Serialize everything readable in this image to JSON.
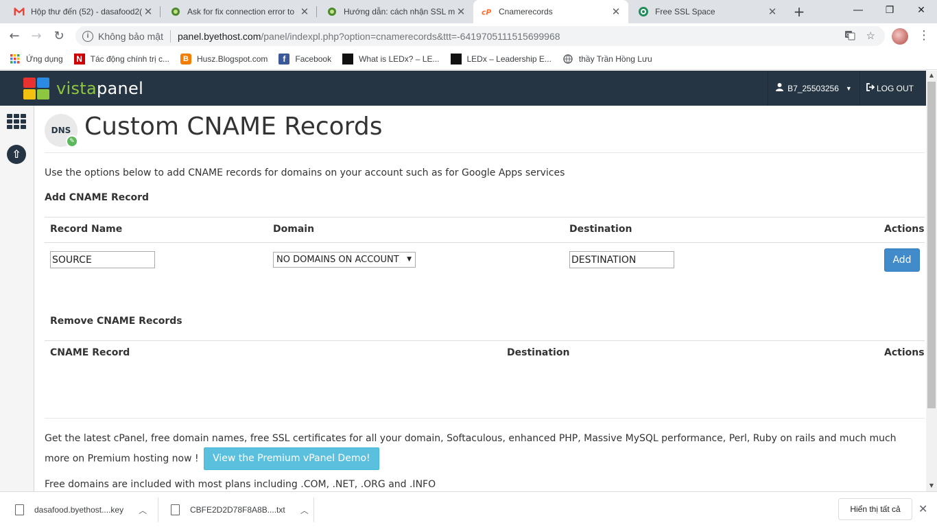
{
  "browser": {
    "tabs": [
      {
        "title": "Hộp thư đến (52) - dasafood2(",
        "icon": "gmail-icon"
      },
      {
        "title": "Ask for fix connection error to",
        "icon": "forum-icon"
      },
      {
        "title": "Hướng dẫn: cách nhận SSL miễ",
        "icon": "forum-icon"
      },
      {
        "title": "Cnamerecords",
        "icon": "cpanel-icon"
      },
      {
        "title": "Free SSL Space",
        "icon": "ssl-icon"
      }
    ],
    "security_label": "Không bảo mật",
    "url_host": "panel.byethost.com",
    "url_path": "/panel/indexpl.php?option=cnamerecords&ttt=-6419705111515699968",
    "bookmarks": [
      {
        "label": "Ứng dụng",
        "icon": "apps-grid-icon"
      },
      {
        "label": "Tác động chính trị c...",
        "icon": "n-logo-icon"
      },
      {
        "label": "Husz.Blogspot.com",
        "icon": "blogger-icon"
      },
      {
        "label": "Facebook",
        "icon": "facebook-icon"
      },
      {
        "label": "What is LEDx?  – LE...",
        "icon": "ledx-icon"
      },
      {
        "label": "LEDx – Leadership E...",
        "icon": "ledx-icon"
      },
      {
        "label": "thầy Trần Hồng Lưu",
        "icon": "globe-icon"
      }
    ]
  },
  "header": {
    "logo_vista": "vista",
    "logo_panel": "panel",
    "username": "B7_25503256",
    "logout_label": "LOG OUT"
  },
  "page": {
    "title": "Custom CNAME Records",
    "dns_badge": "DNS",
    "intro": "Use the options below to add CNAME records for domains on your account such as for Google Apps services",
    "add_section": {
      "heading": "Add CNAME Record",
      "columns": [
        "Record Name",
        "Domain",
        "Destination",
        "Actions"
      ],
      "source_value": "SOURCE",
      "domain_selected": "NO DOMAINS ON ACCOUNT",
      "destination_value": "DESTINATION",
      "add_label": "Add"
    },
    "remove_section": {
      "heading": "Remove CNAME Records",
      "columns": [
        "CNAME Record",
        "Destination",
        "Actions"
      ]
    },
    "promo_text": "Get the latest cPanel, free domain names, free SSL certificates for all your domain, Softaculous, enhanced PHP, Massive MySQL performance, Perl, Ruby on rails and much much more on Premium hosting now !",
    "demo_label": "View the Premium vPanel Demo!",
    "free_domains": "Free domains are included with most plans including .COM, .NET, .ORG and .INFO"
  },
  "downloads": [
    {
      "name": "dasafood.byethost....key"
    },
    {
      "name": "CBFE2D2D78F8A8B....txt"
    }
  ],
  "show_all_label": "Hiển thị tất cả",
  "colors": {
    "header_bg": "#263543",
    "logo_green": "#8dc63f",
    "add_button": "#428bca",
    "demo_button": "#5bc0de"
  }
}
